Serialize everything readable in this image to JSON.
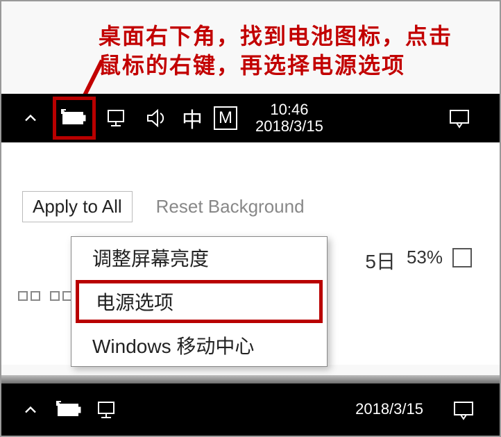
{
  "instruction": "桌面右下角，找到电池图标，点击鼠标的右键，再选择电源选项",
  "taskbar1": {
    "ime_char": "中",
    "ime_mode": "M",
    "time": "10:46",
    "date": "2018/3/15"
  },
  "mid": {
    "apply_btn": "Apply to All",
    "reset_btn": "Reset Background",
    "bg_date_suffix": "5日",
    "bg_percent": "53%"
  },
  "context_menu": {
    "item1": "调整屏幕亮度",
    "item2": "电源选项",
    "item3": "Windows 移动中心"
  },
  "taskbar2": {
    "date": "2018/3/15"
  }
}
